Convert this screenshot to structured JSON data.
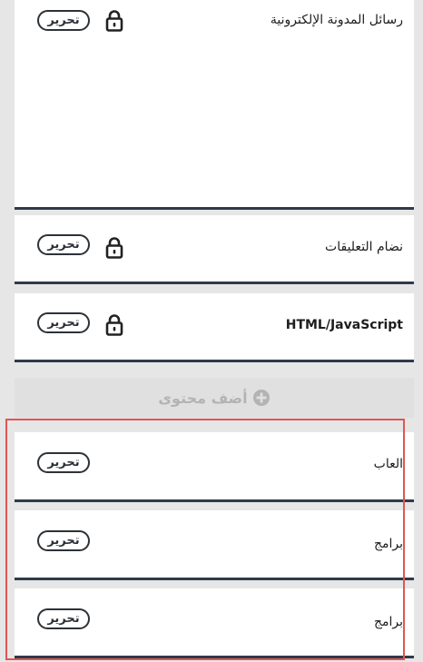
{
  "widgets": [
    {
      "title": "رسائل المدونة الإلكترونية",
      "edit_label": "تحرير",
      "locked": true,
      "icon": "lock-icon"
    },
    {
      "title": "نضام التعليقات",
      "edit_label": "تحرير",
      "locked": true,
      "icon": "lock-icon"
    },
    {
      "title": "HTML/JavaScript",
      "edit_label": "تحرير",
      "locked": true,
      "icon": "lock-icon"
    },
    {
      "title": "العاب",
      "edit_label": "تحرير",
      "locked": false
    },
    {
      "title": "برامج",
      "edit_label": "تحرير",
      "locked": false
    },
    {
      "title": "برامج",
      "edit_label": "تحرير",
      "locked": false
    }
  ],
  "add_content": {
    "label": "أضف محتوى",
    "icon": "plus-circle-icon"
  },
  "colors": {
    "page_background": "#e6e6e6",
    "widget_background": "#ffffff",
    "widget_border": "#2f3a4a",
    "edit_button_border": "#2c3238",
    "add_content_text": "#b3b3b3",
    "highlight": "#e05555"
  }
}
